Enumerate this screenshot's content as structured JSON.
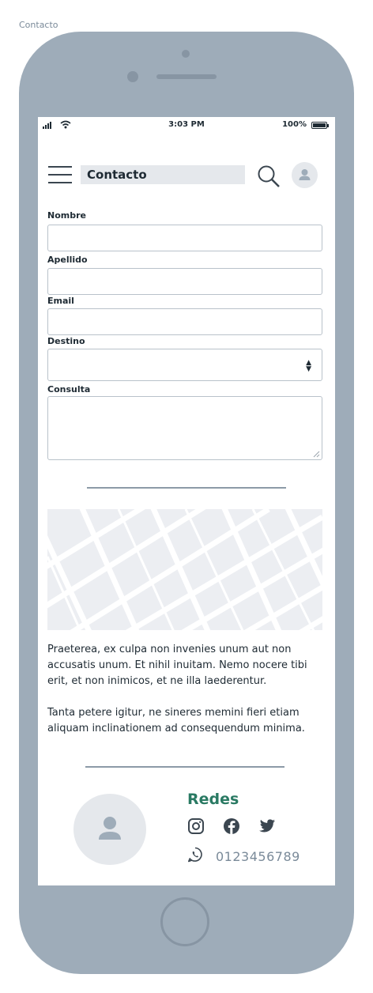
{
  "page": {
    "label": "Contacto"
  },
  "status_bar": {
    "time": "3:03 PM",
    "battery": "100%"
  },
  "header": {
    "title": "Contacto"
  },
  "form": {
    "nombre_label": "Nombre",
    "apellido_label": "Apellido",
    "email_label": "Email",
    "destino_label": "Destino",
    "consulta_label": "Consulta"
  },
  "content": {
    "paragraph1": "Praeterea, ex culpa non invenies unum aut non accusatis unum. Et nihil inuitam. Nemo nocere tibi erit, et non inimicos, et ne illa laederentur.",
    "paragraph2": "Tanta petere igitur, ne sineres memini fieri etiam aliquam inclinationem ad consequendum minima."
  },
  "footer": {
    "redes_title": "Redes",
    "social_icons": [
      "instagram-icon",
      "facebook-icon",
      "twitter-icon"
    ],
    "phone": "0123456789"
  },
  "colors": {
    "device": "#9eacb9",
    "accent_green": "#2a7a63",
    "placeholder": "#e5e8ec",
    "input_border": "#b9c2ca"
  }
}
